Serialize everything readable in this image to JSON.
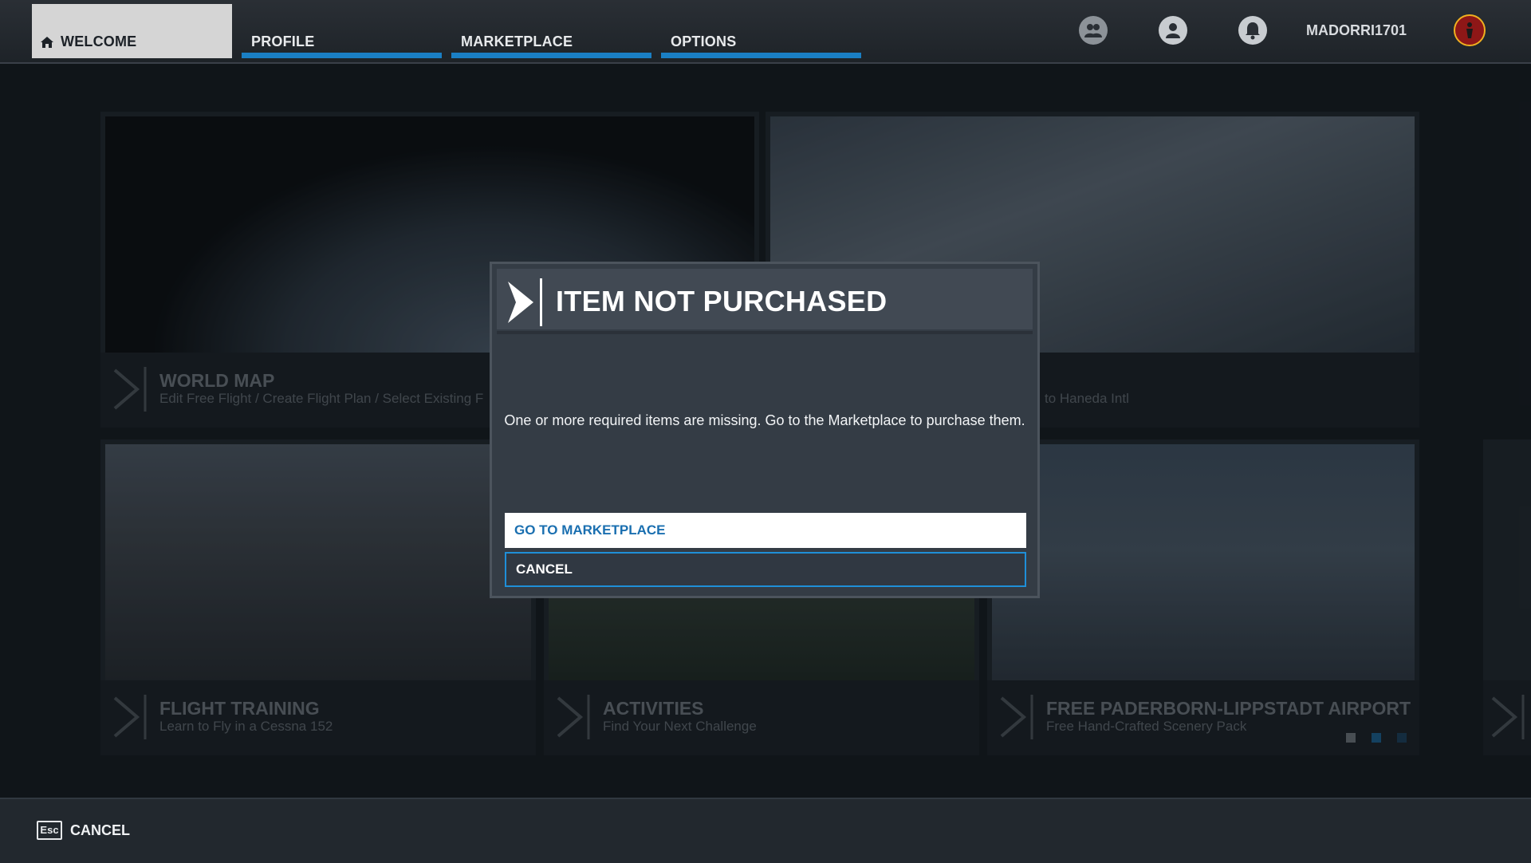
{
  "nav": {
    "tabs": [
      {
        "label": "WELCOME",
        "active": true
      },
      {
        "label": "PROFILE",
        "active": false
      },
      {
        "label": "MARKETPLACE",
        "active": false
      },
      {
        "label": "OPTIONS",
        "active": false
      }
    ],
    "icons": [
      "friends-icon",
      "profile-icon",
      "notifications-icon"
    ],
    "username": "MADORRI1701",
    "accent_color": "#1a7fc4"
  },
  "tiles": [
    {
      "title": "WORLD MAP",
      "subtitle": "Edit Free Flight / Create Flight Plan / Select Existing F"
    },
    {
      "title": "",
      "subtitle": "to Haneda Intl"
    },
    {
      "title": "FLIGHT TRAINING",
      "subtitle": "Learn to Fly in a Cessna 152"
    },
    {
      "title": "ACTIVITIES",
      "subtitle": "Find Your Next Challenge"
    },
    {
      "title": "FREE PADERBORN-LIPPSTADT AIRPORT",
      "subtitle": "Free Hand-Crafted Scenery Pack"
    }
  ],
  "modal": {
    "title": "ITEM NOT PURCHASED",
    "message": "One or more required items are missing. Go to the Marketplace to purchase them.",
    "primary_button": "GO TO MARKETPLACE",
    "secondary_button": "CANCEL"
  },
  "footer": {
    "key": "Esc",
    "action": "CANCEL"
  }
}
